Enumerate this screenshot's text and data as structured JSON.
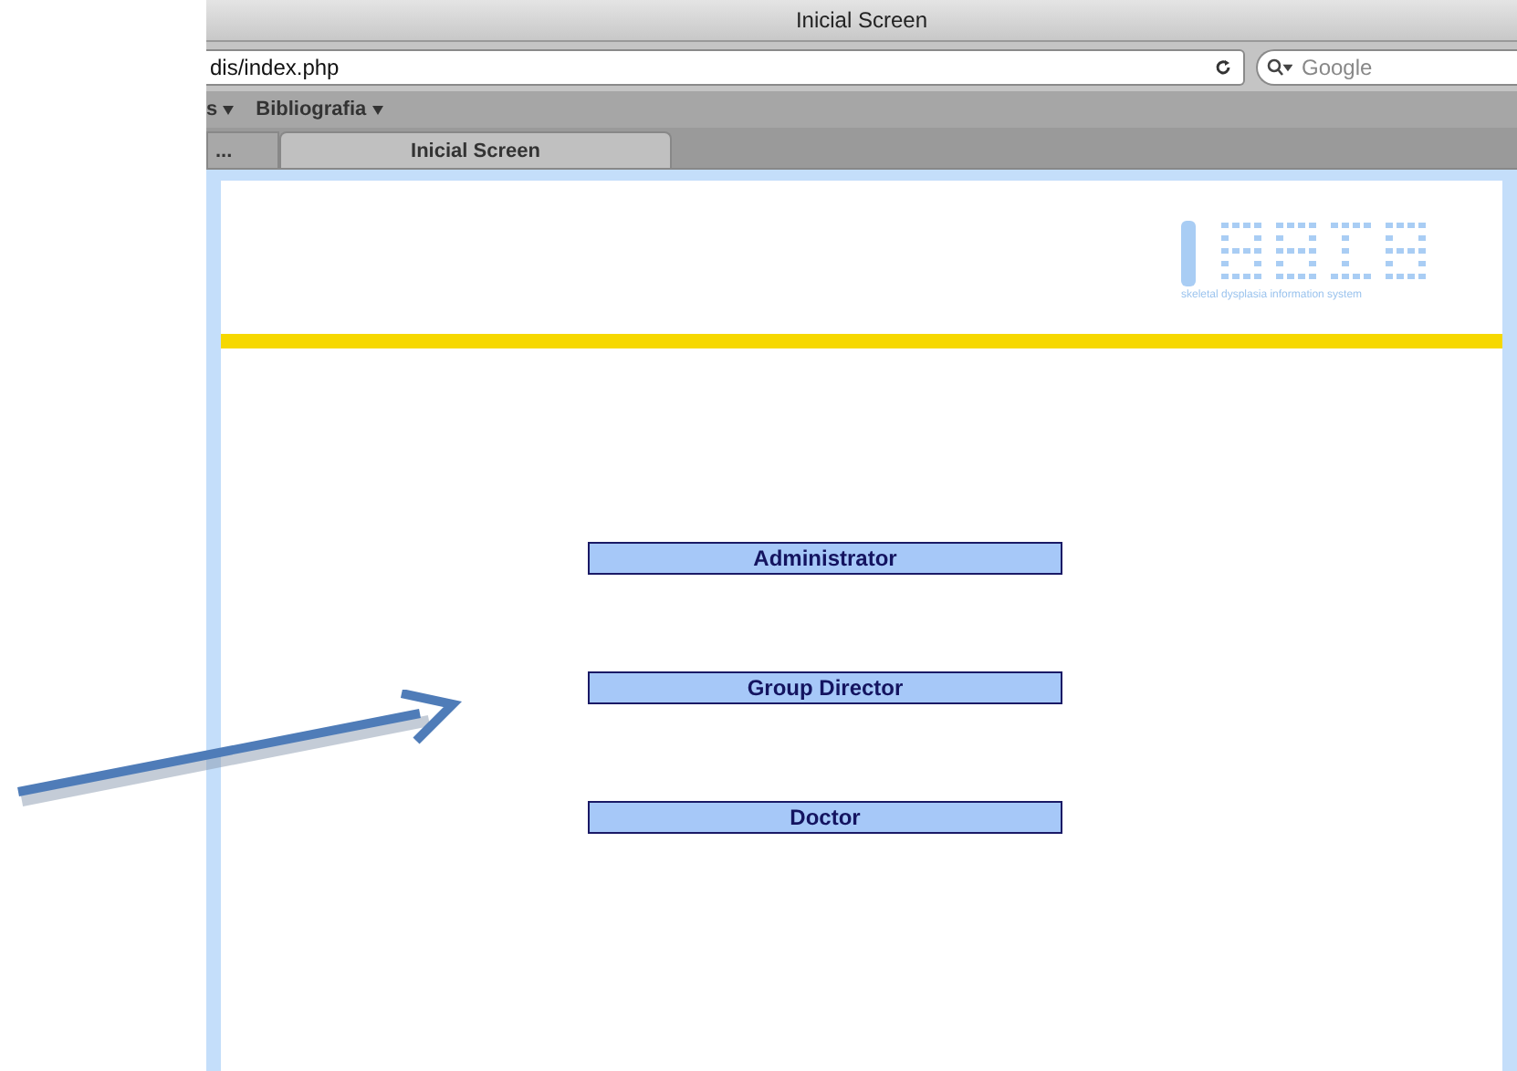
{
  "window": {
    "title": "Inicial Screen"
  },
  "address_bar": {
    "url": "dis/index.php"
  },
  "search": {
    "placeholder": "Google"
  },
  "bookmarks": [
    {
      "label": "s",
      "menu": true
    },
    {
      "label": "Bibliografia",
      "menu": true
    }
  ],
  "tabs": [
    {
      "label": "...",
      "selected": false
    },
    {
      "label": "Inicial Screen",
      "selected": true
    }
  ],
  "logo": {
    "caption": "skeletal dysplasia information system"
  },
  "buttons": [
    {
      "label": "Administrator"
    },
    {
      "label": "Group Director"
    },
    {
      "label": "Doctor"
    }
  ],
  "annotation": {
    "kind": "arrow"
  }
}
